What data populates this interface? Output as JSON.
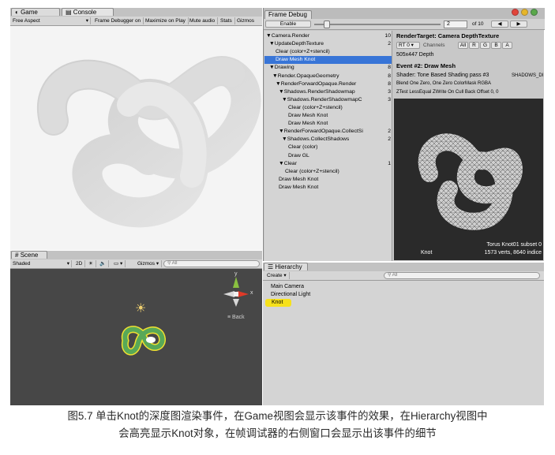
{
  "game": {
    "tab_game": "Game",
    "tab_console": "Console",
    "aspect": "Free Aspect",
    "frame_debugger": "Frame Debugger on",
    "maximize": "Maximize on Play",
    "mute": "Mute audio",
    "stats": "Stats",
    "gizmos": "Gizmos"
  },
  "scene": {
    "tab": "Scene",
    "shading": "Shaded",
    "mode_2d": "2D",
    "gizmos": "Gizmos",
    "search_placeholder": "All",
    "back_label": "Back",
    "axis_y": "y",
    "axis_x": "x"
  },
  "frame_debug": {
    "tab": "Frame Debug",
    "enable": "Enable",
    "event_index": "2",
    "event_total": "of 10",
    "tree": [
      {
        "label": "▼Camera.Render",
        "count": "10",
        "indent": 0
      },
      {
        "label": "▼UpdateDepthTexture",
        "count": "2",
        "indent": 1
      },
      {
        "label": "Clear (color+Z+stencil)",
        "count": "",
        "indent": 3
      },
      {
        "label": "Draw Mesh Knot",
        "count": "",
        "indent": 3,
        "selected": true
      },
      {
        "label": "▼Drawing",
        "count": "8",
        "indent": 1
      },
      {
        "label": "▼Render.OpaqueGeometry",
        "count": "8",
        "indent": 2
      },
      {
        "label": "▼RenderForwardOpaque.Render",
        "count": "8",
        "indent": 3
      },
      {
        "label": "▼Shadows.RenderShadowmap",
        "count": "3",
        "indent": 4
      },
      {
        "label": "▼Shadows.RenderShadowmapC",
        "count": "3",
        "indent": 5
      },
      {
        "label": "Clear (color+Z+stencil)",
        "count": "",
        "indent": 7
      },
      {
        "label": "Draw Mesh Knot",
        "count": "",
        "indent": 7
      },
      {
        "label": "Draw Mesh Knot",
        "count": "",
        "indent": 7
      },
      {
        "label": "▼RenderForwardOpaque.CollectSi",
        "count": "2",
        "indent": 4
      },
      {
        "label": "▼Shadows.CollectShadows",
        "count": "2",
        "indent": 5
      },
      {
        "label": "Clear (color)",
        "count": "",
        "indent": 7
      },
      {
        "label": "Draw GL",
        "count": "",
        "indent": 7
      },
      {
        "label": "▼Clear",
        "count": "1",
        "indent": 4
      },
      {
        "label": "Clear (color+Z+stencil)",
        "count": "",
        "indent": 6
      },
      {
        "label": "Draw Mesh Knot",
        "count": "",
        "indent": 4
      },
      {
        "label": "Draw Mesh Knot",
        "count": "",
        "indent": 4
      }
    ],
    "render_target": "RenderTarget: Camera DepthTexture",
    "rt_select": "RT 0",
    "channels_label": "Channels",
    "channels": [
      "All",
      "R",
      "G",
      "B",
      "A"
    ],
    "size": "505x447 Depth",
    "event_title": "Event #2: Draw Mesh",
    "shader": "Shader: Tone Based Shading pass #3",
    "shader_keyword": "SHADOWS_DI",
    "blend": "Blend One Zero, One Zero ColorMask RGBA",
    "ztest": "ZTest LessEqual ZWrite On Cull Back Offset 0, 0",
    "preview_name": "Knot",
    "preview_info_1": "Torus Knot01 subset 0",
    "preview_info_2": "1573 verts, 8640 indice"
  },
  "hierarchy": {
    "tab": "Hierarchy",
    "create": "Create",
    "search_placeholder": "All",
    "items": [
      "Main Camera",
      "Directional Light",
      "Knot"
    ]
  },
  "caption": {
    "line1": "图5.7 单击Knot的深度图渲染事件，在Game视图会显示该事件的效果，在Hierarchy视图中",
    "line2": "会高亮显示Knot对象，在帧调试器的右侧窗口会显示出该事件的细节"
  },
  "colors": {
    "selection": "#3875d7",
    "highlight": "#f6e11b",
    "scene_bg": "#474747"
  }
}
